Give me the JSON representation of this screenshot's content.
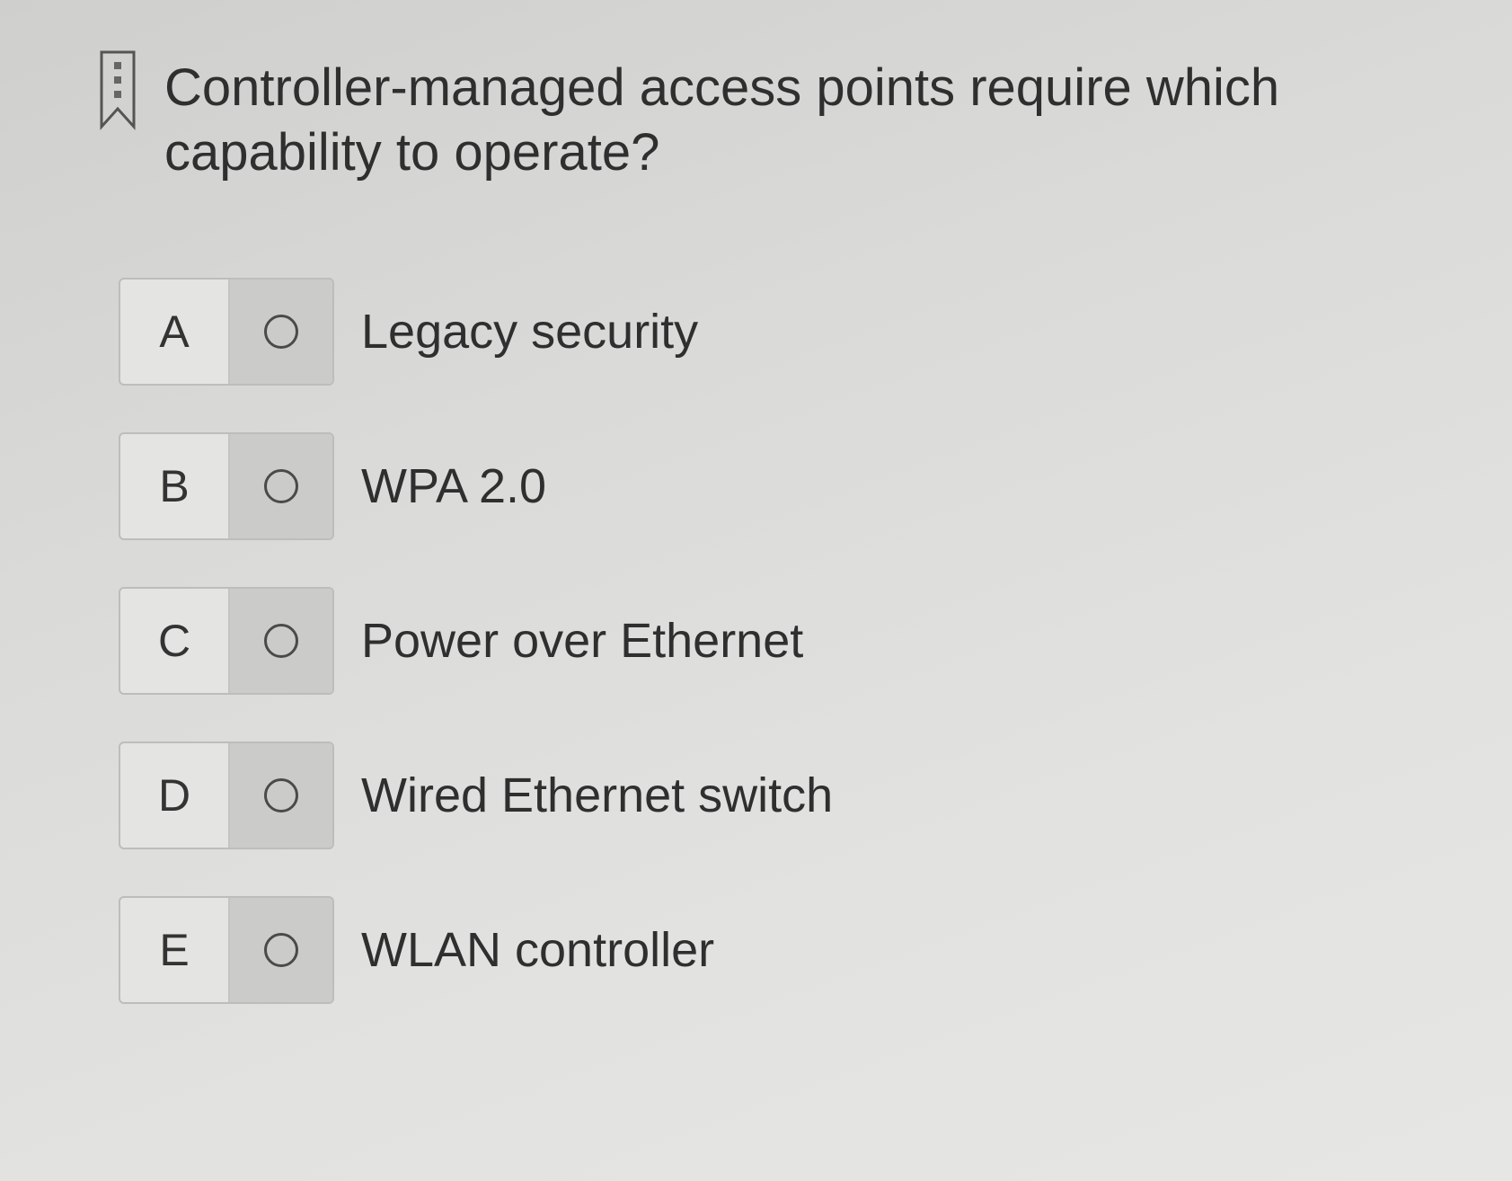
{
  "question": {
    "text": "Controller-managed access points require which capability to operate?"
  },
  "options": [
    {
      "letter": "A",
      "label": "Legacy security"
    },
    {
      "letter": "B",
      "label": "WPA 2.0"
    },
    {
      "letter": "C",
      "label": "Power over Ethernet"
    },
    {
      "letter": "D",
      "label": "Wired Ethernet switch"
    },
    {
      "letter": "E",
      "label": "WLAN controller"
    }
  ],
  "icons": {
    "bookmark": "bookmark-icon",
    "radio": "radio-button-icon"
  }
}
